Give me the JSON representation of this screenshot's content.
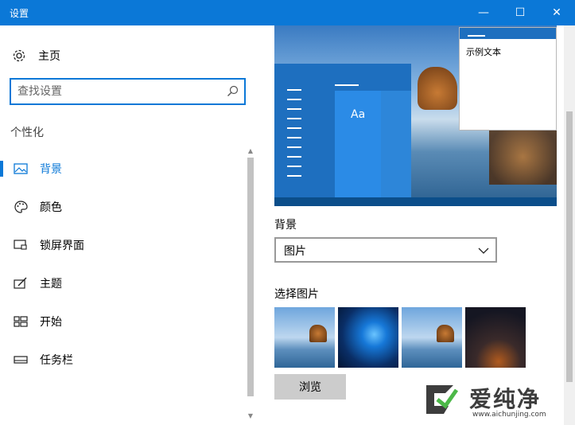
{
  "window": {
    "title": "设置",
    "minimize": "—",
    "maximize": "☐",
    "close": "✕"
  },
  "sidebar": {
    "home_label": "主页",
    "search_placeholder": "查找设置",
    "section_label": "个性化",
    "items": [
      {
        "label": "背景",
        "icon": "picture-icon",
        "active": true
      },
      {
        "label": "颜色",
        "icon": "palette-icon"
      },
      {
        "label": "锁屏界面",
        "icon": "lock-screen-icon"
      },
      {
        "label": "主题",
        "icon": "theme-icon"
      },
      {
        "label": "开始",
        "icon": "start-icon"
      },
      {
        "label": "任务栏",
        "icon": "taskbar-icon"
      }
    ]
  },
  "main": {
    "preview": {
      "sample_text": "示例文本",
      "tile_text": "Aa"
    },
    "background_label": "背景",
    "background_value": "图片",
    "choose_label": "选择图片",
    "browse_label": "浏览"
  },
  "watermark": {
    "text": "爱纯净",
    "url": "www.aichunjing.com"
  },
  "colors": {
    "accent": "#0b78d7",
    "button_gray": "#cccccc"
  }
}
